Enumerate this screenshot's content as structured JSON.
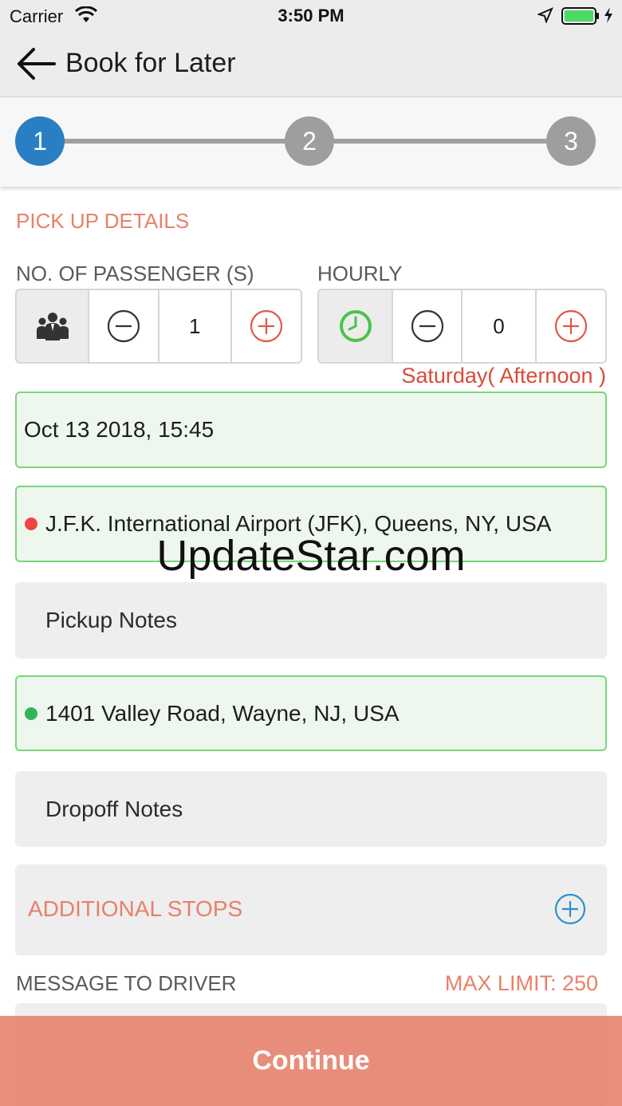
{
  "status_bar": {
    "carrier": "Carrier",
    "time": "3:50 PM",
    "battery_color": "#4cd964"
  },
  "nav": {
    "title": "Book for Later",
    "back_icon": "arrow-left-icon"
  },
  "steps": [
    {
      "label": "1",
      "state": "active"
    },
    {
      "label": "2",
      "state": "inactive"
    },
    {
      "label": "3",
      "state": "inactive"
    }
  ],
  "pickup": {
    "section_title": "PICK UP DETAILS",
    "passengers_label": "NO. OF PASSENGER (S)",
    "passengers_value": "1",
    "hourly_label": "HOURLY",
    "hourly_value": "0",
    "day_note": "Saturday( Afternoon )",
    "datetime": "Oct 13 2018, 15:45",
    "pickup_address": "J.F.K. International Airport (JFK), Queens, NY, USA",
    "pickup_notes_placeholder": "Pickup Notes",
    "dropoff_address": "1401 Valley Road, Wayne, NJ, USA",
    "dropoff_notes_placeholder": "Dropoff Notes",
    "additional_stops_label": "ADDITIONAL STOPS",
    "message_label": "MESSAGE TO DRIVER",
    "max_limit": "MAX LIMIT: 250"
  },
  "continue_label": "Continue",
  "watermark": "UpdateStar.com",
  "colors": {
    "accent": "#e8806b",
    "step_active": "#2a7fc4",
    "step_inactive": "#9e9e9e",
    "field_border_green": "#79d579",
    "pickup_dot": "#ef4444",
    "dropoff_dot": "#34b35a",
    "day_note": "#d84b3a"
  }
}
